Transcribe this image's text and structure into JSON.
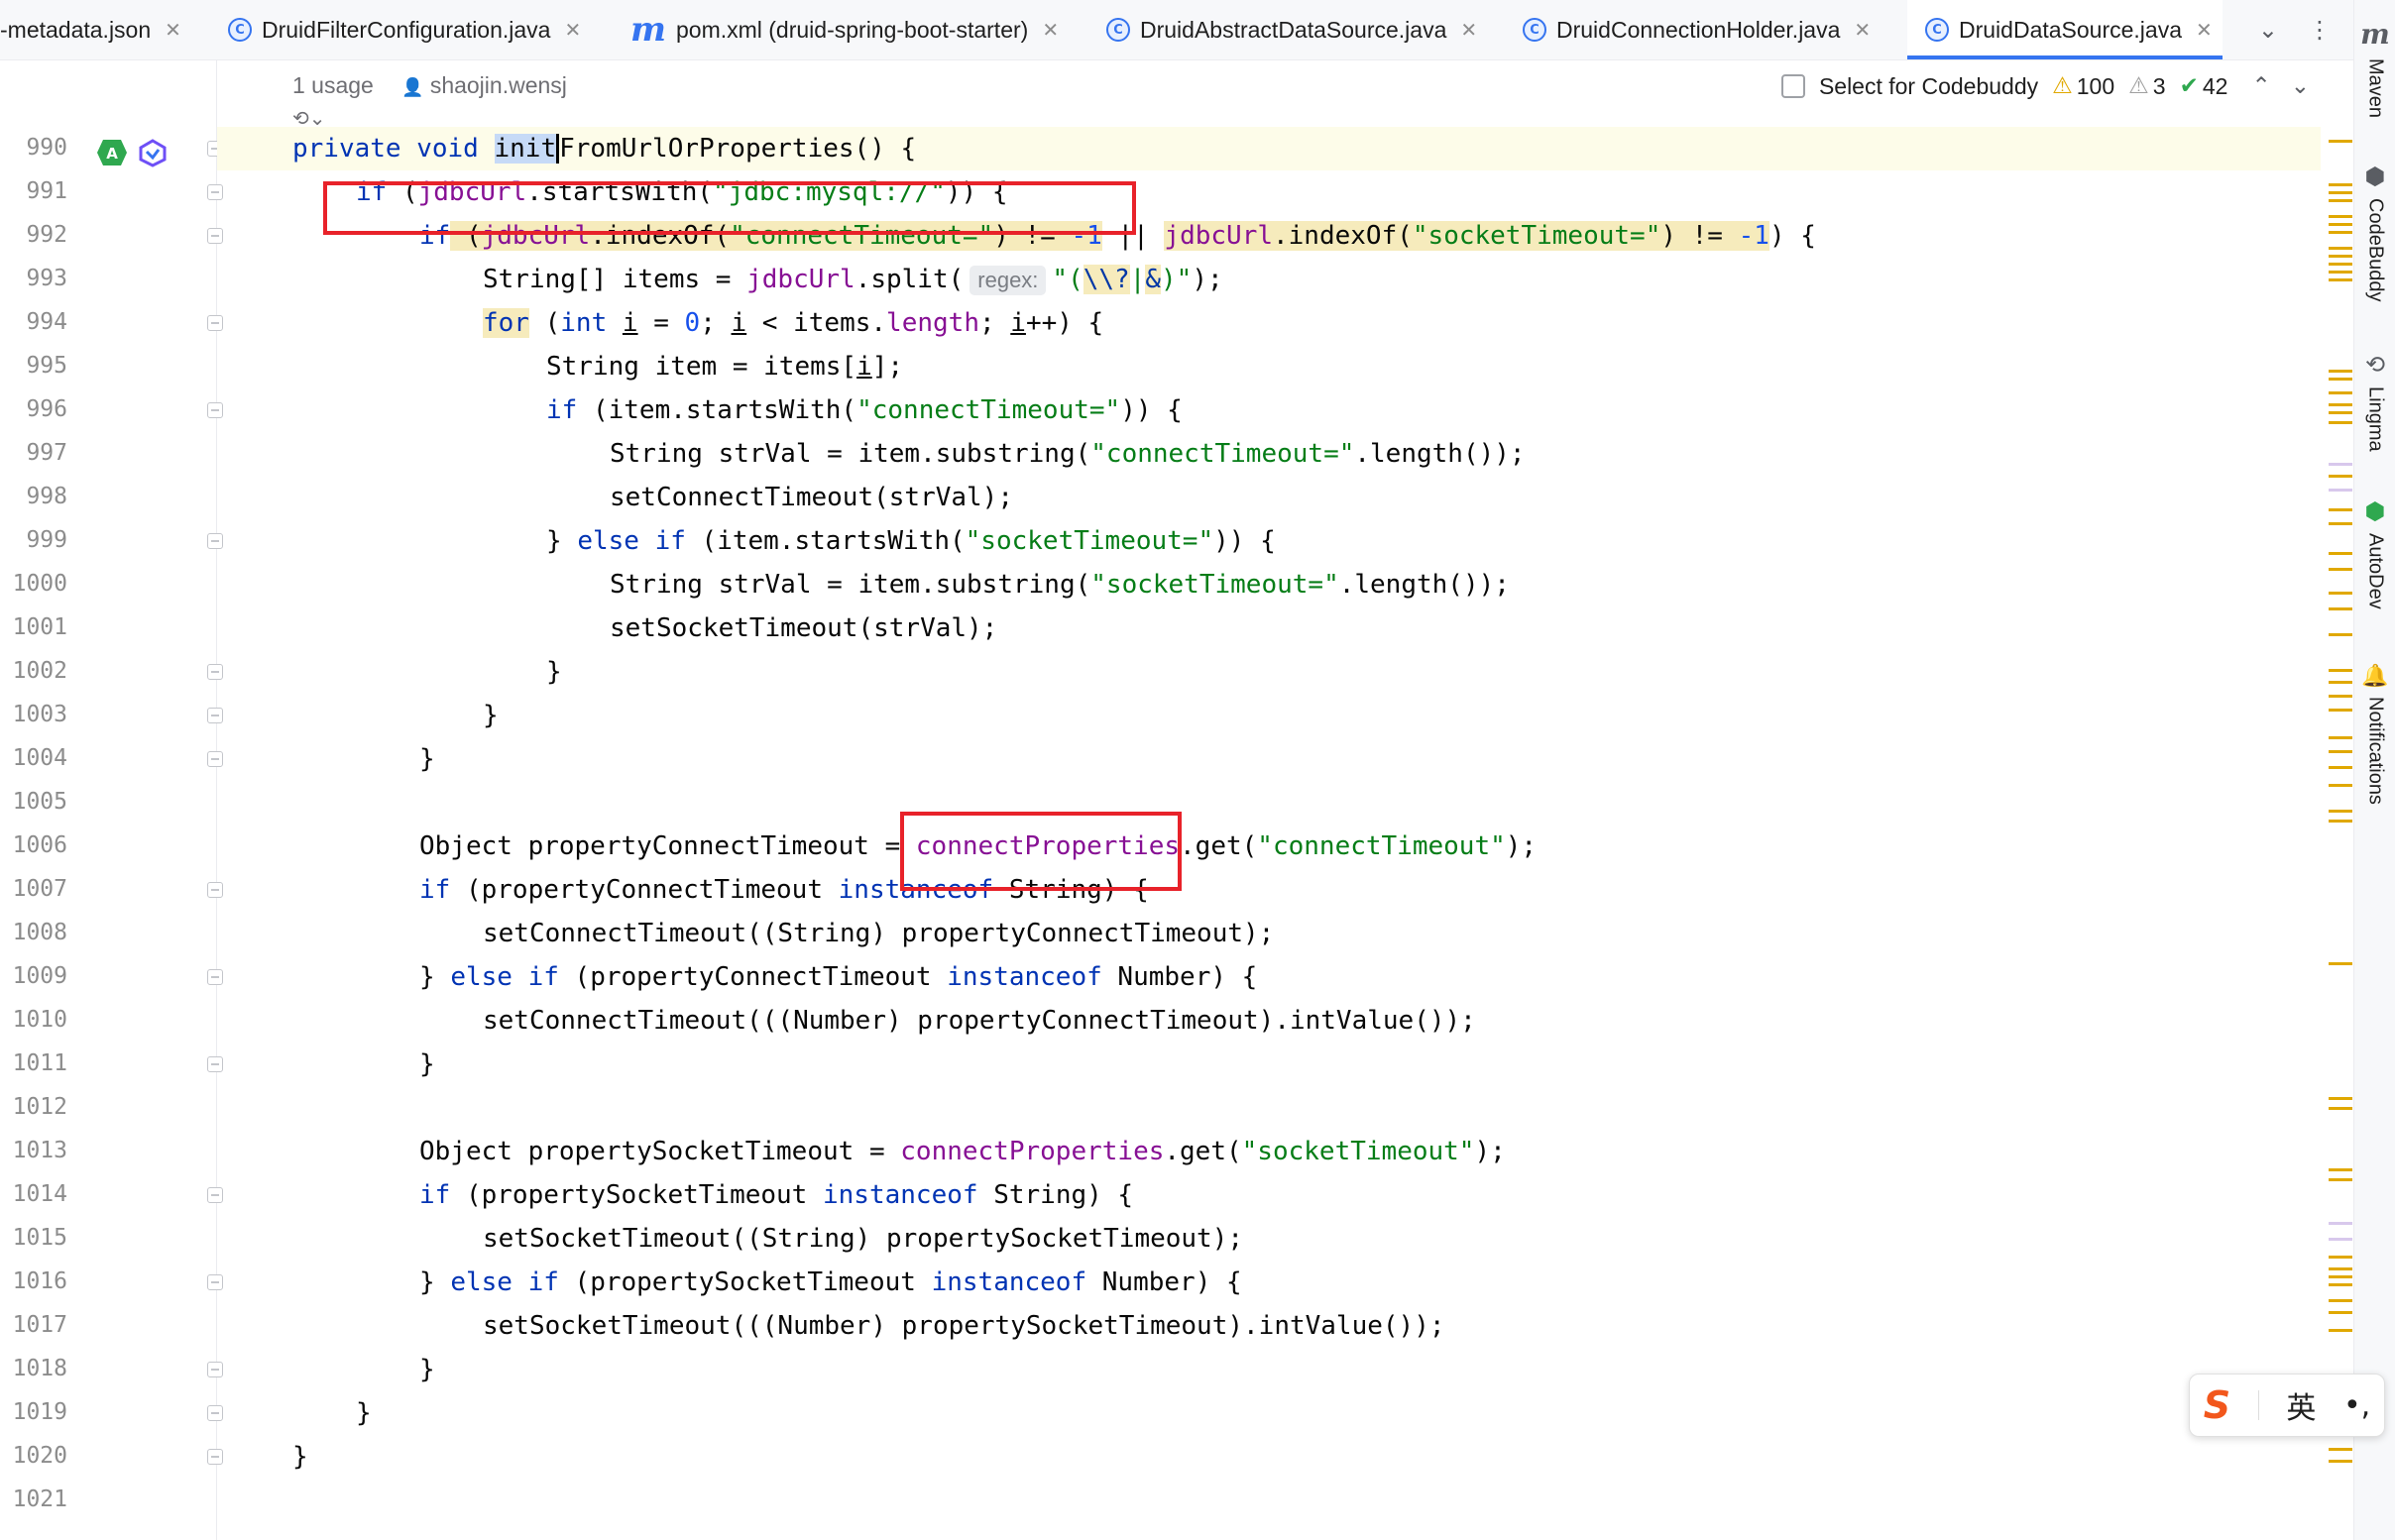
{
  "tabs": [
    {
      "label": "-metadata.json",
      "icon": "json-file-icon",
      "active": false
    },
    {
      "label": "DruidFilterConfiguration.java",
      "icon": "java-class-icon",
      "active": false
    },
    {
      "label": "pom.xml (druid-spring-boot-starter)",
      "icon": "maven-file-icon",
      "active": false
    },
    {
      "label": "DruidAbstractDataSource.java",
      "icon": "java-class-icon",
      "active": false
    },
    {
      "label": "DruidConnectionHolder.java",
      "icon": "java-class-icon",
      "active": false
    },
    {
      "label": "DruidDataSource.java",
      "icon": "java-class-icon",
      "active": true
    }
  ],
  "code_meta": {
    "usage": "1 usage",
    "author": "shaojin.wensj"
  },
  "inspection": {
    "select_label": "Select for Codebuddy",
    "warnings": "100",
    "weak_warnings": "3",
    "typos": "42"
  },
  "right_tools": [
    "Maven",
    "CodeBuddy",
    "Lingma",
    "AutoDev",
    "Notifications"
  ],
  "line_numbers": [
    "990",
    "991",
    "992",
    "993",
    "994",
    "995",
    "996",
    "997",
    "998",
    "999",
    "1000",
    "1001",
    "1002",
    "1003",
    "1004",
    "1005",
    "1006",
    "1007",
    "1008",
    "1009",
    "1010",
    "1011",
    "1012",
    "1013",
    "1014",
    "1015",
    "1016",
    "1017",
    "1018",
    "1019",
    "1020",
    "1021"
  ],
  "code": {
    "l990": {
      "kw1": "private void ",
      "sel": "init",
      "rest": "FromUrlOrProperties() {"
    },
    "l991": {
      "kw": "if",
      "a": " (",
      "fld": "jdbcUrl",
      "b": ".startsWith(",
      "str": "\"jdbc:mysql://\"",
      "c": ")) {"
    },
    "l992": {
      "kw": "if",
      "a": " (",
      "fld1": "jdbcUrl",
      "b": ".indexOf(",
      "str1": "\"connectTimeout=\"",
      "c": ") != ",
      "num1": "-1",
      "d": " || ",
      "fld2": "jdbcUrl",
      "e": ".indexOf(",
      "str2": "\"socketTimeout=\"",
      "f": ") != ",
      "num2": "-1",
      "g": ") {"
    },
    "l993": {
      "a": "String[] items = ",
      "fld": "jdbcUrl",
      "b": ".split(",
      "hint": "regex:",
      "str1": "\"(",
      "str2": "\\\\?",
      "str3": "|",
      "str4": "&",
      "str5": ")\"",
      "c": ");"
    },
    "l994": {
      "kw1": "for",
      "a": " (",
      "kw2": "int",
      "b": " ",
      "v1": "i",
      "c": " = ",
      "num": "0",
      "d": "; ",
      "v2": "i",
      "e": " < items.",
      "fld": "length",
      "f": "; ",
      "v3": "i",
      "g": "++) {"
    },
    "l995": {
      "a": "String item = items[",
      "v": "i",
      "b": "];"
    },
    "l996": {
      "kw": "if",
      "a": " (item.startsWith(",
      "str": "\"connectTimeout=\"",
      "b": ")) {"
    },
    "l997": {
      "a": "String strVal = item.substring(",
      "str": "\"connectTimeout=\"",
      "b": ".length());"
    },
    "l998": {
      "a": "setConnectTimeout(strVal);"
    },
    "l999": {
      "a": "} ",
      "kw1": "else if",
      "b": " (item.startsWith(",
      "str": "\"socketTimeout=\"",
      "c": ")) {"
    },
    "l1000": {
      "a": "String strVal = item.substring(",
      "str": "\"socketTimeout=\"",
      "b": ".length());"
    },
    "l1001": {
      "a": "setSocketTimeout(strVal);"
    },
    "l1002": {
      "a": "}"
    },
    "l1003": {
      "a": "}"
    },
    "l1004": {
      "a": "}"
    },
    "l1006": {
      "a": "Object propertyConnectTimeout = ",
      "fld": "connectProperties",
      "b": ".get(",
      "str": "\"connectTimeout\"",
      "c": ");"
    },
    "l1007": {
      "kw1": "if",
      "a": " (propertyConnectTimeout ",
      "kw2": "instanceof",
      "b": " String) {"
    },
    "l1008": {
      "a": "setConnectTimeout((String) propertyConnectTimeout);"
    },
    "l1009": {
      "a": "} ",
      "kw1": "else if",
      "b": " (propertyConnectTimeout ",
      "kw2": "instanceof",
      "c": " Number) {"
    },
    "l1010": {
      "a": "setConnectTimeout(((Number) propertyConnectTimeout).intValue());"
    },
    "l1011": {
      "a": "}"
    },
    "l1013": {
      "a": "Object propertySocketTimeout = ",
      "fld": "connectProperties",
      "b": ".get(",
      "str": "\"socketTimeout\"",
      "c": ");"
    },
    "l1014": {
      "kw1": "if",
      "a": " (propertySocketTimeout ",
      "kw2": "instanceof",
      "b": " String) {"
    },
    "l1015": {
      "a": "setSocketTimeout((String) propertySocketTimeout);"
    },
    "l1016": {
      "a": "} ",
      "kw1": "else if",
      "b": " (propertySocketTimeout ",
      "kw2": "instanceof",
      "c": " Number) {"
    },
    "l1017": {
      "a": "setSocketTimeout(((Number) propertySocketTimeout).intValue());"
    },
    "l1018": {
      "a": "}"
    },
    "l1019": {
      "a": "}"
    },
    "l1020": {
      "a": "}"
    }
  },
  "ime": {
    "lang": "英"
  },
  "colors": {
    "keyword": "#0033b3",
    "string": "#067d17",
    "number": "#1750eb",
    "field": "#871094",
    "annotation_box": "#e8222a",
    "accent": "#3574f0"
  }
}
